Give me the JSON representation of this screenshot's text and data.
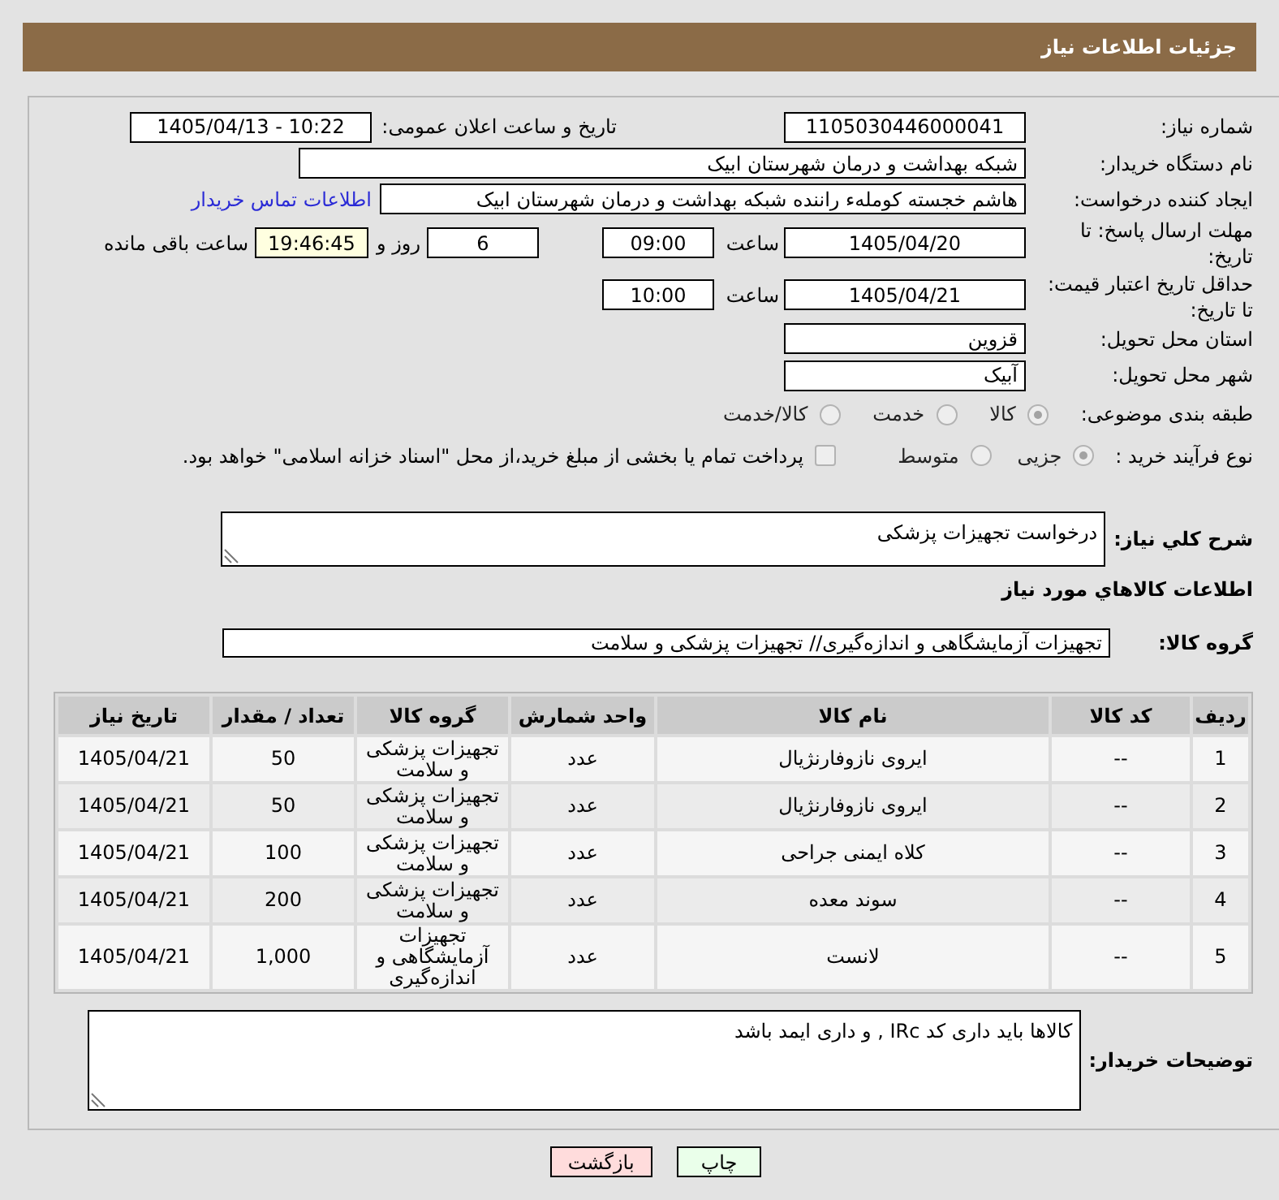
{
  "header": {
    "title": "جزئیات اطلاعات نیاز"
  },
  "details": {
    "need_number": {
      "label": "شماره نیاز:",
      "value": "1105030446000041"
    },
    "announcement": {
      "label": "تاریخ و ساعت اعلان عمومی:",
      "value": "1405/04/13 - 10:22"
    },
    "buyer": {
      "label": "نام دستگاه خریدار:",
      "value": "شبکه بهداشت و درمان شهرستان ابیک"
    },
    "requester": {
      "label": "ایجاد کننده درخواست:",
      "value": "هاشم خجسته کوملهء راننده شبکه بهداشت و درمان شهرستان ابیک",
      "link": "اطلاعات تماس خریدار"
    },
    "reply_deadline": {
      "label": "مهلت ارسال پاسخ: تا تاریخ:",
      "date": "1405/04/20",
      "time_label": "ساعت",
      "time": "09:00",
      "days": "6",
      "days_label": "روز و",
      "remaining": "19:46:45",
      "remaining_label": "ساعت باقی مانده"
    },
    "price_validity": {
      "label": "حداقل تاریخ اعتبار قیمت: تا تاریخ:",
      "date": "1405/04/21",
      "time_label": "ساعت",
      "time": "10:00"
    },
    "province": {
      "label": "استان محل تحویل:",
      "value": "قزوین"
    },
    "city": {
      "label": "شهر محل تحویل:",
      "value": "آبیک"
    },
    "category": {
      "label": "طبقه بندی موضوعی:",
      "options": [
        {
          "label": "کالا",
          "selected": true,
          "disabled": true
        },
        {
          "label": "خدمت",
          "selected": false,
          "disabled": true
        },
        {
          "label": "کالا/خدمت",
          "selected": false,
          "disabled": true
        }
      ]
    },
    "purchase_type": {
      "label": "نوع فرآیند خرید :",
      "options": [
        {
          "label": "جزیی",
          "selected": true,
          "disabled": true
        },
        {
          "label": "متوسط",
          "selected": false,
          "disabled": true
        }
      ],
      "treasury_payment": {
        "label": "پرداخت تمام یا بخشی از مبلغ خرید،از محل \"اسناد خزانه اسلامی\" خواهد بود.",
        "checked": false,
        "disabled": true
      }
    }
  },
  "description": {
    "label": "شرح کلي نياز:",
    "value": "درخواست تجهیزات پزشکی"
  },
  "goods": {
    "title": "اطلاعات کالاهاي مورد نياز",
    "group_label": "گروه کالا:",
    "group_value": "تجهیزات آزمایشگاهی و اندازه‌گیری// تجهیزات پزشکی و سلامت"
  },
  "table": {
    "columns": [
      "ردیف",
      "کد کالا",
      "نام کالا",
      "واحد شمارش",
      "گروه کالا",
      "تعداد / مقدار",
      "تاریخ نیاز"
    ],
    "rows": [
      [
        "1",
        "--",
        "ایروی نازوفارنژیال",
        "عدد",
        "تجهیزات پزشکی و سلامت",
        "50",
        "1405/04/21"
      ],
      [
        "2",
        "--",
        "ایروی نازوفارنژیال",
        "عدد",
        "تجهیزات پزشکی و سلامت",
        "50",
        "1405/04/21"
      ],
      [
        "3",
        "--",
        "کلاه ایمنی جراحی",
        "عدد",
        "تجهیزات پزشکی و سلامت",
        "100",
        "1405/04/21"
      ],
      [
        "4",
        "--",
        "سوند معده",
        "عدد",
        "تجهیزات پزشکی و سلامت",
        "200",
        "1405/04/21"
      ],
      [
        "5",
        "--",
        "لانست",
        "عدد",
        "تجهیزات آزمایشگاهی و اندازه‌گیری",
        "1,000",
        "1405/04/21"
      ]
    ]
  },
  "buyer_notes": {
    "label": "توضیحات خریدار:",
    "value": "کالاها باید داری کد IRc , و داری ایمد باشد"
  },
  "buttons": [
    {
      "label": "چاپ",
      "kind": "print"
    },
    {
      "label": "بازگشت",
      "kind": "back"
    }
  ]
}
